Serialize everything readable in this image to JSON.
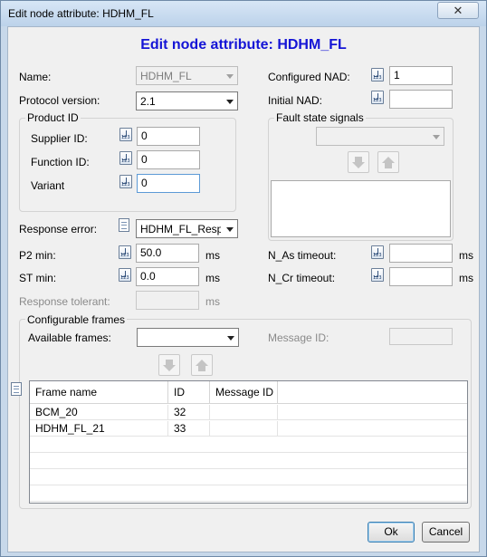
{
  "window": {
    "title": "Edit node attribute: HDHM_FL",
    "close_label": "✕"
  },
  "dialog": {
    "heading": "Edit node attribute: HDHM_FL"
  },
  "fields": {
    "name": {
      "label": "Name:",
      "value": "HDHM_FL"
    },
    "protocol_version": {
      "label": "Protocol version:",
      "value": "2.1"
    },
    "configured_nad": {
      "label": "Configured NAD:",
      "value": "1"
    },
    "initial_nad": {
      "label": "Initial NAD:",
      "value": ""
    },
    "product_id": {
      "title": "Product ID",
      "supplier_id": {
        "label": "Supplier ID:",
        "value": "0"
      },
      "function_id": {
        "label": "Function ID:",
        "value": "0"
      },
      "variant": {
        "label": "Variant",
        "value": "0"
      }
    },
    "fault_state": {
      "title": "Fault state signals",
      "selected": ""
    },
    "response_error": {
      "label": "Response error:",
      "value": "HDHM_FL_Respons"
    },
    "p2_min": {
      "label": "P2 min:",
      "value": "50.0",
      "unit": "ms"
    },
    "st_min": {
      "label": "ST min:",
      "value": "0.0",
      "unit": "ms"
    },
    "n_as_timeout": {
      "label": "N_As timeout:",
      "value": "",
      "unit": "ms"
    },
    "n_cr_timeout": {
      "label": "N_Cr timeout:",
      "value": "",
      "unit": "ms"
    },
    "response_tolerant": {
      "label": "Response tolerant:",
      "value": "",
      "unit": "ms"
    }
  },
  "frames": {
    "title": "Configurable frames",
    "available_label": "Available frames:",
    "available_value": "",
    "message_id_label": "Message ID:",
    "message_id_value": "",
    "columns": [
      "Frame name",
      "ID",
      "Message ID"
    ],
    "rows": [
      [
        "BCM_20",
        "32",
        ""
      ],
      [
        "HDHM_FL_21",
        "33",
        ""
      ]
    ]
  },
  "buttons": {
    "ok": "Ok",
    "cancel": "Cancel"
  }
}
